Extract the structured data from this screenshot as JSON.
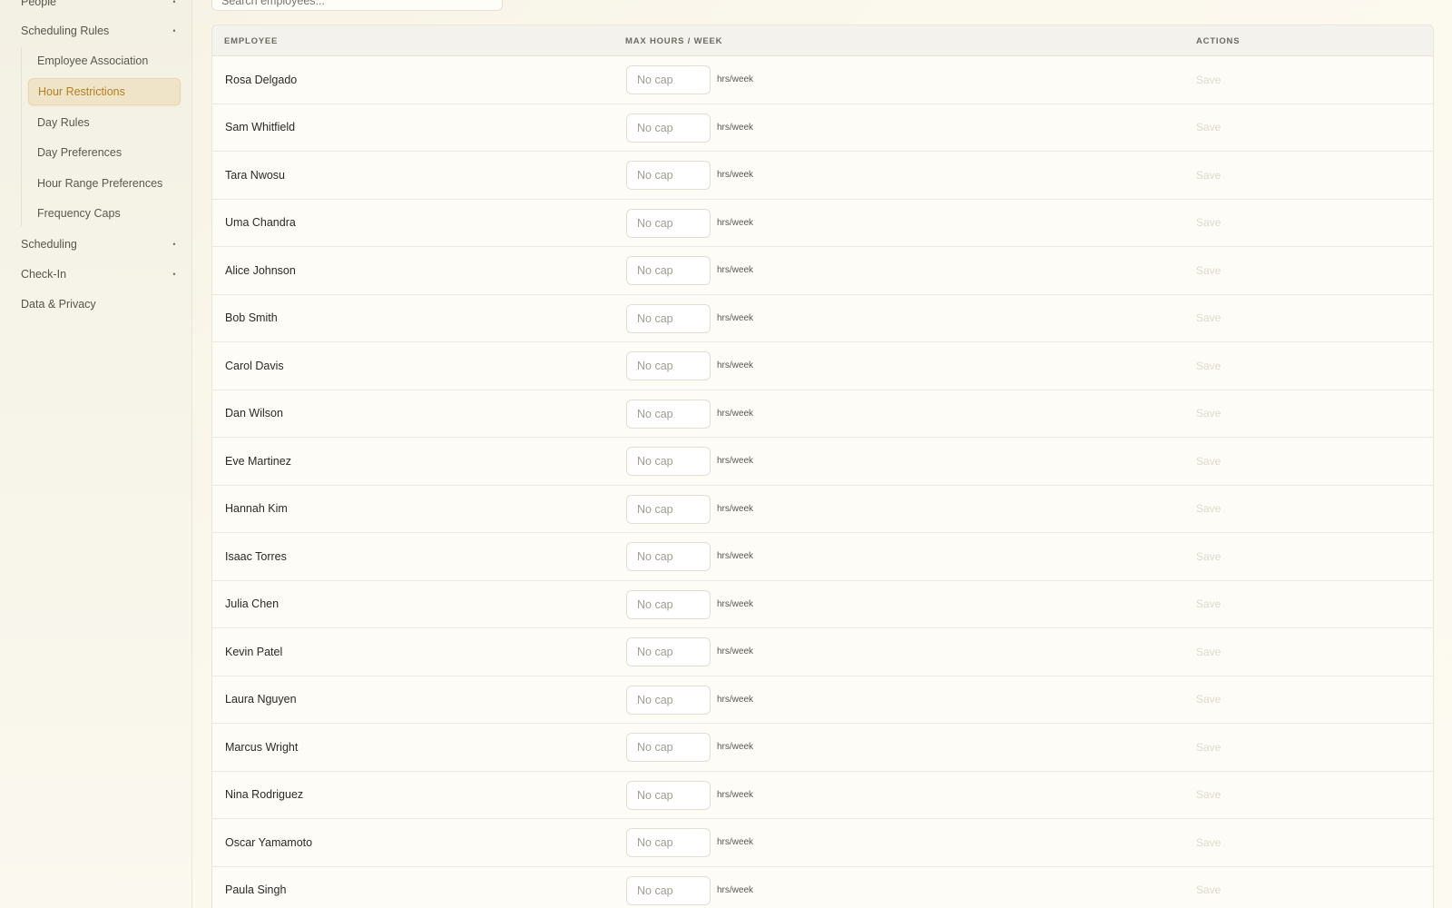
{
  "sidebar": {
    "people": {
      "label": "People",
      "marker": "•"
    },
    "scheduling_rules": {
      "label": "Scheduling Rules",
      "marker": "•"
    },
    "sub_items": [
      {
        "label": "Employee Association"
      },
      {
        "label": "Hour Restrictions"
      },
      {
        "label": "Day Rules"
      },
      {
        "label": "Day Preferences"
      },
      {
        "label": "Hour Range Preferences"
      },
      {
        "label": "Frequency Caps"
      }
    ],
    "scheduling": {
      "label": "Scheduling",
      "marker": "•"
    },
    "check_in": {
      "label": "Check-In",
      "marker": "•"
    },
    "data_privacy": {
      "label": "Data & Privacy"
    },
    "active_item": "Hour Restrictions"
  },
  "search": {
    "placeholder": "Search employees..."
  },
  "table": {
    "headers": {
      "employee": "EMPLOYEE",
      "max_hours": "MAX HOURS / WEEK",
      "actions": "ACTIONS"
    },
    "input_placeholder": "No cap",
    "unit_label": "hrs/week",
    "save_label": "Save",
    "rows": [
      {
        "name": "Rosa Delgado"
      },
      {
        "name": "Sam Whitfield"
      },
      {
        "name": "Tara Nwosu"
      },
      {
        "name": "Uma Chandra"
      },
      {
        "name": "Alice Johnson"
      },
      {
        "name": "Bob Smith"
      },
      {
        "name": "Carol Davis"
      },
      {
        "name": "Dan Wilson"
      },
      {
        "name": "Eve Martinez"
      },
      {
        "name": "Hannah Kim"
      },
      {
        "name": "Isaac Torres"
      },
      {
        "name": "Julia Chen"
      },
      {
        "name": "Kevin Patel"
      },
      {
        "name": "Laura Nguyen"
      },
      {
        "name": "Marcus Wright"
      },
      {
        "name": "Nina Rodriguez"
      },
      {
        "name": "Oscar Yamamoto"
      },
      {
        "name": "Paula Singh"
      }
    ]
  },
  "colors": {
    "accent": "#b07f26",
    "active_bg": "#f0e4c8",
    "disabled_save": "#ddd9cc"
  }
}
